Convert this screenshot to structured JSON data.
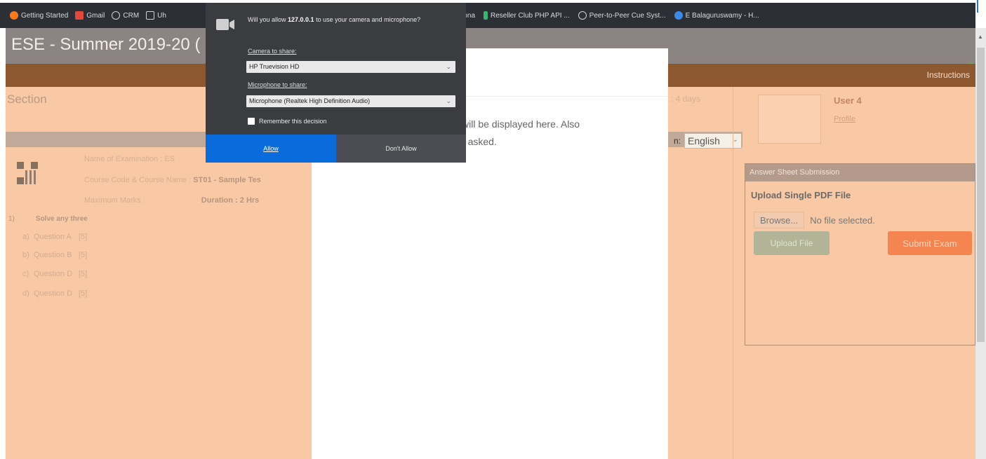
{
  "bookmarks": {
    "left": [
      {
        "label": "Getting Started",
        "icon": "firefox-icon",
        "color": "#ff7a1a"
      },
      {
        "label": "Gmail",
        "icon": "mail-icon",
        "color": "#e2483c"
      },
      {
        "label": "CRM",
        "icon": "globe-icon",
        "color": "#cfd3d8"
      },
      {
        "label": "Uh",
        "icon": "folder-icon",
        "color": "#cfd3d8"
      }
    ],
    "right": [
      {
        "label": "rona",
        "icon": "",
        "color": ""
      },
      {
        "label": "Reseller Club PHP API ...",
        "icon": "bookmark-icon",
        "color": "#3cb371"
      },
      {
        "label": "Peer-to-Peer Cue Syst...",
        "icon": "globe-icon",
        "color": "#cfd3d8"
      },
      {
        "label": "E Balaguruswamy - H...",
        "icon": "s-icon",
        "color": "#3c8ce7"
      }
    ]
  },
  "page": {
    "title": "ESE - Summer 2019-20 (",
    "nav": {
      "instructions": "Instructions"
    },
    "section_label": "Section",
    "days_left": ": 4 days",
    "language": {
      "prefix": "n:",
      "selected": "English"
    },
    "exam_info": [
      {
        "label": "Name of Examination : ES",
        "value": ""
      },
      {
        "label": "Course Code & Course Name : ",
        "value": "ST01 - Sample Tes"
      },
      {
        "label": "Maximum Marks :",
        "value": "Duration : 2 Hrs"
      }
    ],
    "question": {
      "number": "1)",
      "text": "Solve any three",
      "sub": [
        {
          "n": "a)",
          "text": "Question A",
          "marks": "[5]"
        },
        {
          "n": "b)",
          "text": "Question B",
          "marks": "[5]"
        },
        {
          "n": "c)",
          "text": "Question D",
          "marks": "[5]"
        },
        {
          "n": "d)",
          "text": "Question D",
          "marks": "[5]"
        }
      ]
    }
  },
  "user": {
    "name": "User 4",
    "profile": "Profile"
  },
  "answer_sheet": {
    "heading": "Answer Sheet Submission",
    "upload_title": "Upload Single PDF File",
    "browse": "Browse...",
    "no_file": "No file selected.",
    "upload_button": "Upload File",
    "submit_button": "Submit Exam"
  },
  "modal": {
    "line1": "w will be displayed here. Also",
    "line2": "n if asked."
  },
  "permission": {
    "message_pre": "Will you allow ",
    "host": "127.0.0.1",
    "message_post": " to use your camera and microphone?",
    "camera_label": "Camera to share:",
    "camera_value": "HP Truevision HD",
    "mic_label": "Microphone to share:",
    "mic_value": "Microphone (Realtek High Definition Audio)",
    "remember": "Remember this decision",
    "allow": "Allow",
    "deny": "Don't Allow"
  }
}
